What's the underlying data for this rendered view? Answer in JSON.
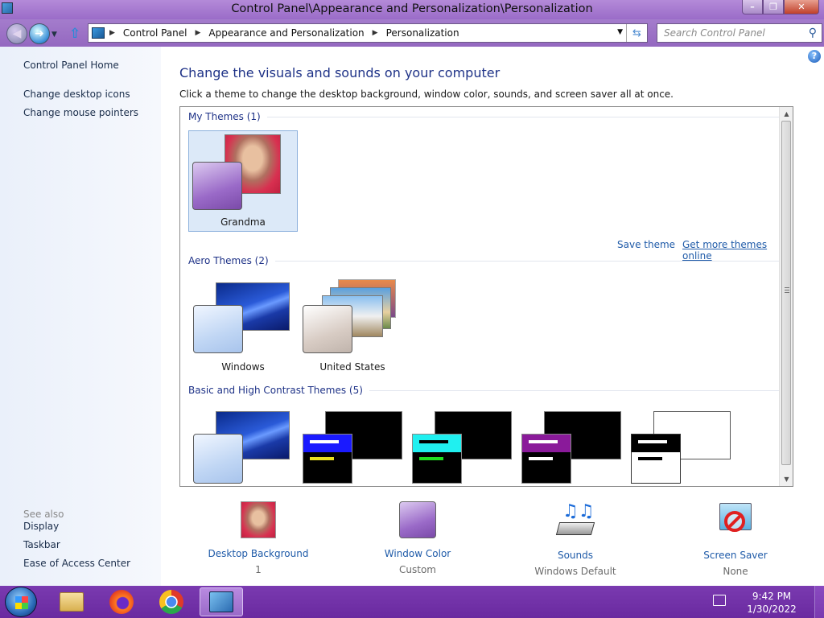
{
  "window": {
    "title": "Control Panel\\Appearance and Personalization\\Personalization"
  },
  "address": {
    "segments": [
      "Control Panel",
      "Appearance and Personalization",
      "Personalization"
    ],
    "search_placeholder": "Search Control Panel"
  },
  "sidebar": {
    "home": "Control Panel Home",
    "links": [
      "Change desktop icons",
      "Change mouse pointers"
    ],
    "see_also_label": "See also",
    "see_also": [
      "Display",
      "Taskbar",
      "Ease of Access Center"
    ]
  },
  "main": {
    "heading": "Change the visuals and sounds on your computer",
    "subtext": "Click a theme to change the desktop background, window color, sounds, and screen saver all at once.",
    "groups": [
      {
        "title": "My Themes (1)",
        "themes": [
          {
            "label": "Grandma",
            "selected": true
          }
        ]
      },
      {
        "title": "Aero Themes (2)",
        "themes": [
          {
            "label": "Windows"
          },
          {
            "label": "United States"
          }
        ]
      },
      {
        "title": "Basic and High Contrast Themes (5)",
        "themes": []
      }
    ],
    "save_theme": "Save theme",
    "get_more": "Get more themes online"
  },
  "bottom": [
    {
      "name": "Desktop Background",
      "value": "1"
    },
    {
      "name": "Window Color",
      "value": "Custom"
    },
    {
      "name": "Sounds",
      "value": "Windows Default"
    },
    {
      "name": "Screen Saver",
      "value": "None"
    }
  ],
  "taskbar": {
    "time": "9:42 PM",
    "date": "1/30/2022"
  },
  "colors": {
    "accent": "#1e3287",
    "link": "#1e5aa8",
    "taskbar": "#6a2aa0"
  }
}
